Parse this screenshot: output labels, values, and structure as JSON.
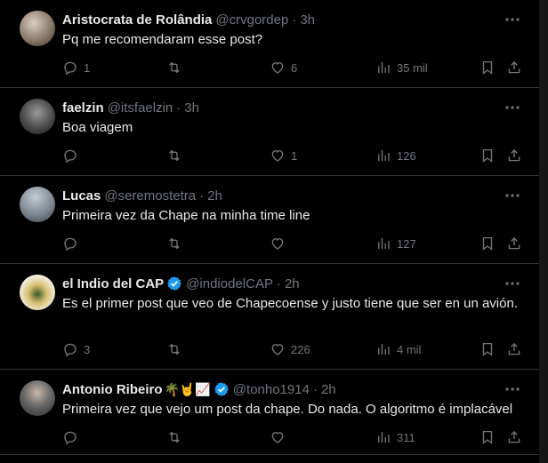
{
  "tweets": [
    {
      "name": "Aristocrata de Rolândia",
      "handle": "@crvgordep",
      "time": "3h",
      "text": "Pq me recomendaram esse post?",
      "replies": "1",
      "retweets": "",
      "likes": "6",
      "views": "35 mil",
      "verified": false,
      "avatar_color": "#8a7a6a"
    },
    {
      "name": "faelzin",
      "handle": "@itsfaelzin",
      "time": "3h",
      "text": "Boa viagem",
      "replies": "",
      "retweets": "",
      "likes": "1",
      "views": "126",
      "verified": false,
      "avatar_color": "#4a4a4a"
    },
    {
      "name": "Lucas",
      "handle": "@seremostetra",
      "time": "2h",
      "text": "Primeira vez da Chape na minha time line",
      "replies": "",
      "retweets": "",
      "likes": "",
      "views": "127",
      "verified": false,
      "avatar_color": "#7d8791"
    },
    {
      "name": "el Indio del CAP",
      "handle": "@indiodelCAP",
      "time": "2h",
      "text": "Es el primer post que veo de Chapecoense y justo tiene que ser en un avión.",
      "replies": "3",
      "retweets": "",
      "likes": "226",
      "views": "4 mil",
      "verified": true,
      "avatar_color": "#e8e0c8"
    },
    {
      "name": "Antonio Ribeiro",
      "handle": "@tonho1914",
      "time": "2h",
      "text": "Primeira vez que vejo um post da chape. Do nada. O algoritmo é implacável",
      "replies": "",
      "retweets": "",
      "likes": "",
      "views": "311",
      "verified": true,
      "emojis": "🌴🤘📈",
      "avatar_color": "#5a5a5a"
    }
  ],
  "colors": {
    "background": "#000000",
    "text": "#e7e9ea",
    "muted": "#71767b",
    "border": "#2f3336",
    "verified": "#1d9bf0"
  }
}
